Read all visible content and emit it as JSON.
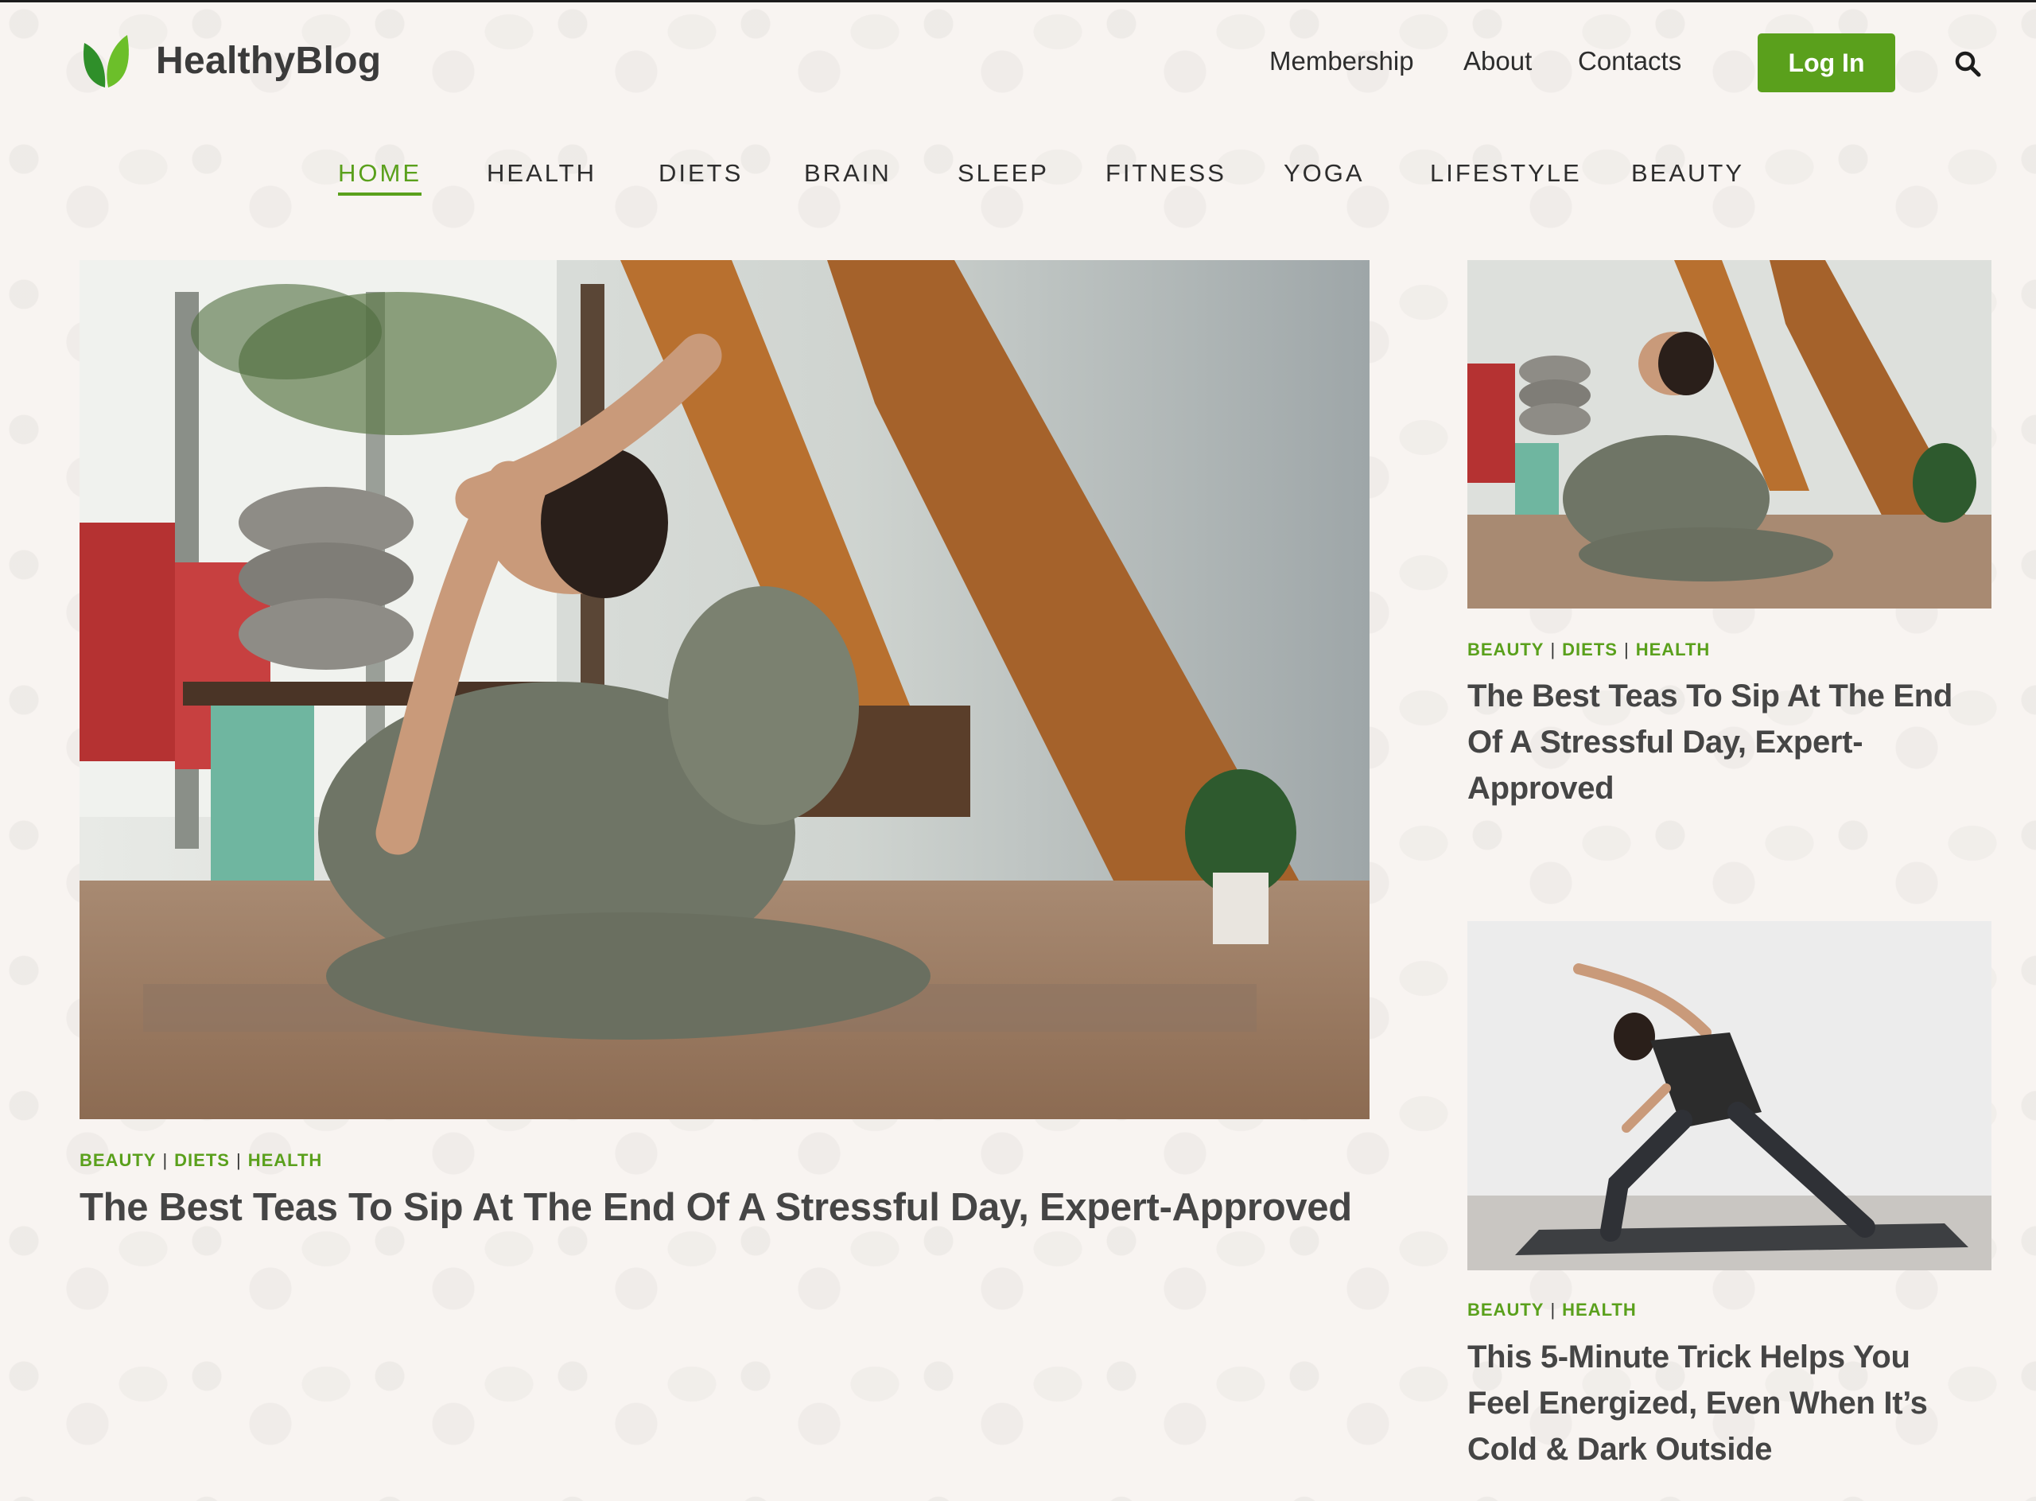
{
  "site": {
    "name": "HealthyBlog"
  },
  "topnav": {
    "items": [
      "Membership",
      "About",
      "Contacts"
    ],
    "login_label": "Log In"
  },
  "categories": [
    "HOME",
    "HEALTH",
    "DIETS",
    "BRAIN",
    "SLEEP",
    "FITNESS",
    "YOGA",
    "LIFESTYLE",
    "BEAUTY"
  ],
  "active_category": "HOME",
  "featured": {
    "tags": [
      "BEAUTY",
      "DIETS",
      "HEALTH"
    ],
    "title": "The Best Teas To Sip At The End Of A Stressful Day, Expert-Approved"
  },
  "side_posts": [
    {
      "tags": [
        "BEAUTY",
        "DIETS",
        "HEALTH"
      ],
      "title_lines": [
        "The Best Teas To Sip At The End",
        "Of A Stressful Day, Expert-",
        "Approved"
      ]
    },
    {
      "tags": [
        "BEAUTY",
        "HEALTH"
      ],
      "title_lines": [
        "This 5-Minute Trick Helps You",
        "Feel Energized, Even When It’s",
        "Cold & Dark Outside"
      ]
    }
  ],
  "colors": {
    "accent": "#5aa01c",
    "background": "#f8f4f1",
    "text": "#454545"
  },
  "icons": {
    "logo": "leaf-logo-icon",
    "search": "search-icon"
  }
}
